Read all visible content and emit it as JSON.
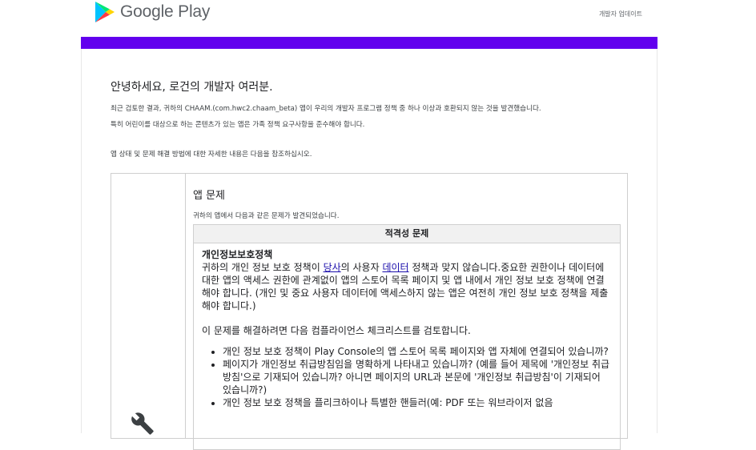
{
  "header": {
    "brand": "Google Play",
    "link": "개발자 업데이트"
  },
  "colors": {
    "band": "#6200ee",
    "link": "#1a0dab"
  },
  "greeting": "안녕하세요, 로건의 개발자 여러분.",
  "intro_line1": "최근 검토한 결과, 귀하의 CHAAM.(com.hwc2.chaam_beta) 앱이 우리의 개발자 프로그램 정책 중 하나 이상과 호환되지 않는 것을 발견했습니다.",
  "intro_line2": "특히 어린이를 대상으로 하는 콘텐츠가 있는 앱은 가족 정책 요구사항을 준수해야 합니다.",
  "intro_line3": "앱 상태 및 문제 해결 방법에 대한 자세한 내용은 다음을 참조하십시오.",
  "issue": {
    "title": "앱 문제",
    "subtitle": "귀하의 앱에서 다음과 같은 문제가 발견되었습니다.",
    "table_header": "적격성 문제",
    "policy_title": "개인정보보호정책",
    "policy_text_a": "귀하의 개인 정보 보호 정책이 ",
    "policy_link1": "당사",
    "policy_text_b": "의 사용자 ",
    "policy_link2": "데이터",
    "policy_text_c": " 정책과 맞지 않습니다.중요한 권한이나 데이터에 대한 앱의 액세스 권한에 관계없이 앱의 스토어 목록 페이지 및 앱 내에서 개인 정보 보호 정책에 연결해야 합니다. (개인 및 중요 사용자 데이터에 액세스하지 않는 앱은 여전히 개인 정보 보호 정책을 제출해야 합니다.)",
    "checklist_intro": "이 문제를 해결하려면 다음 컴플라이언스 체크리스트를 검토합니다.",
    "checklist": [
      "개인 정보 보호 정책이 Play Console의 앱 스토어 목록 페이지와 앱 자체에 연결되어 있습니까?",
      "페이지가 개인정보 취급방침임을 명확하게 나타내고 있습니까? (예를 들어 제목에 '개인정보 취급방침'으로 기재되어 있습니까? 아니면 페이지의 URL과 본문에 '개인정보 취급방침'이 기재되어 있습니까?)",
      "개인 정보 보호 정책을 플리크하이나 특별한 핸들러(예: PDF 또는 워브라이저 없음"
    ]
  }
}
